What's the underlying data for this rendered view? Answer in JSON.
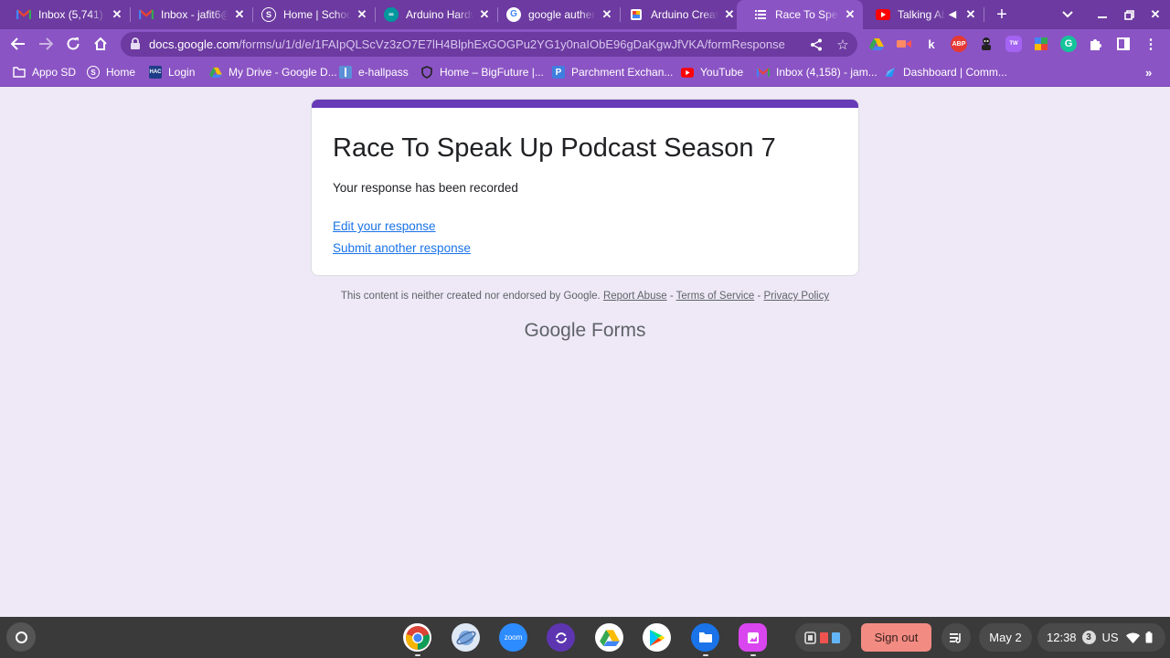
{
  "tabs": [
    {
      "label": "Inbox (5,741) -",
      "icon": "gmail-icon"
    },
    {
      "label": "Inbox - jafit6@",
      "icon": "gmail-icon"
    },
    {
      "label": "Home | School",
      "icon": "schoology-icon"
    },
    {
      "label": "Arduino Hardw",
      "icon": "arduino-icon"
    },
    {
      "label": "google authen",
      "icon": "google-icon"
    },
    {
      "label": "Arduino Creat",
      "icon": "arduino-create-icon"
    },
    {
      "label": "Race To Speak",
      "icon": "google-forms-icon"
    },
    {
      "label": "Talking Ab",
      "icon": "youtube-icon"
    }
  ],
  "address_bar": {
    "domain": "docs.google.com",
    "path": "/forms/u/1/d/e/1FAIpQLScVz3zO7E7lH4BlphExGOGPu2YG1y0naIObE96gDaKgwJfVKA/formResponse"
  },
  "bookmarks": [
    {
      "label": "Appo SD",
      "icon": "folder-icon"
    },
    {
      "label": "Home",
      "icon": "schoology-icon"
    },
    {
      "label": "Login",
      "icon": "hac-icon",
      "badge": "HAC"
    },
    {
      "label": "My Drive - Google D...",
      "icon": "google-drive-icon"
    },
    {
      "label": "e-hallpass",
      "icon": "ehallpass-icon"
    },
    {
      "label": "Home – BigFuture |...",
      "icon": "shield-icon"
    },
    {
      "label": "Parchment Exchan...",
      "icon": "parchment-icon",
      "badge": "P"
    },
    {
      "label": "YouTube",
      "icon": "youtube-icon"
    },
    {
      "label": "Inbox (4,158) - jam...",
      "icon": "gmail-icon"
    },
    {
      "label": "Dashboard | Comm...",
      "icon": "dashboard-icon"
    }
  ],
  "form": {
    "title": "Race To Speak Up Podcast Season 7",
    "confirmation": "Your response has been recorded",
    "edit_link": "Edit your response",
    "submit_another_link": "Submit another response"
  },
  "footer": {
    "disclaimer": "This content is neither created nor endorsed by Google.",
    "report_abuse": "Report Abuse",
    "sep1": " - ",
    "terms": "Terms of Service",
    "sep2": " - ",
    "privacy": "Privacy Policy",
    "brand_google": "Google",
    "brand_forms": "Forms"
  },
  "extensions": {
    "abp_label": "ABP",
    "k_label": "k"
  },
  "shelf": {
    "zoom_label": "zoom",
    "sign_out": "Sign out",
    "date": "May 2",
    "time": "12:38",
    "notification_count": "3",
    "locale": "US"
  },
  "colors": {
    "chrome_dark": "#6c3aa0",
    "chrome_light": "#8b54c4",
    "form_accent": "#673ab7",
    "page_bg": "#efe9f7",
    "link": "#1a73e8",
    "sign_out_bg": "#f28b82"
  }
}
